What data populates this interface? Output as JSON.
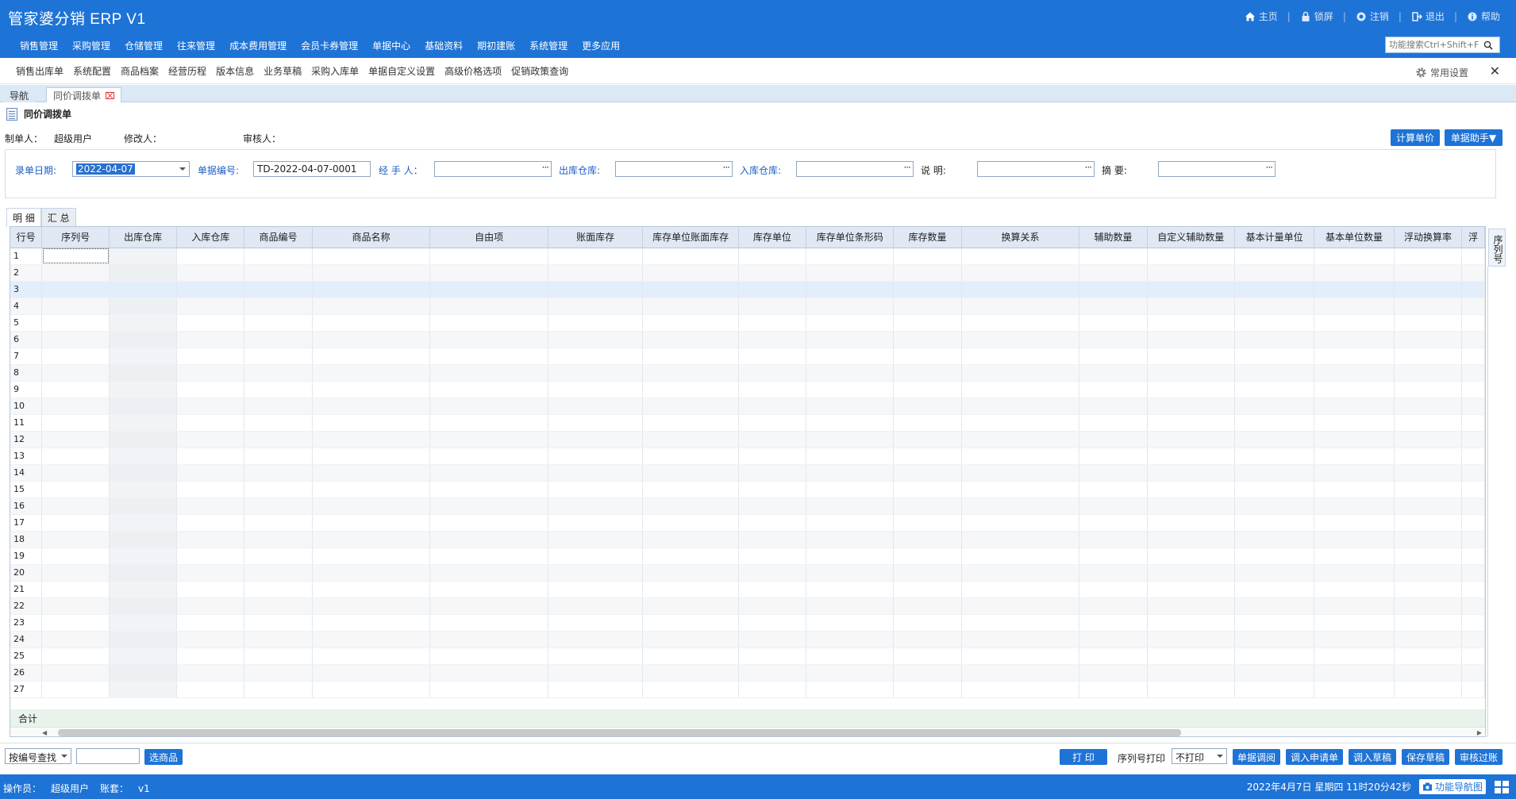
{
  "app": {
    "title": "管家婆分销 ERP V1"
  },
  "top_links": [
    {
      "icon": "home-icon",
      "label": "主页"
    },
    {
      "icon": "lock-icon",
      "label": "锁屏"
    },
    {
      "icon": "logout-circle-icon",
      "label": "注销"
    },
    {
      "icon": "exit-icon",
      "label": "退出"
    },
    {
      "icon": "help-icon",
      "label": "帮助"
    }
  ],
  "main_nav": [
    "销售管理",
    "采购管理",
    "仓储管理",
    "往来管理",
    "成本费用管理",
    "会员卡券管理",
    "单据中心",
    "基础资料",
    "期初建账",
    "系统管理",
    "更多应用"
  ],
  "search": {
    "placeholder": "功能搜索Ctrl+Shift+F"
  },
  "sub_nav": [
    "销售出库单",
    "系统配置",
    "商品档案",
    "经营历程",
    "版本信息",
    "业务草稿",
    "采购入库单",
    "单据自定义设置",
    "高级价格选项",
    "促销政策查询"
  ],
  "common_settings": "常用设置",
  "tabs": {
    "nav": "导航",
    "active": "同价调拨单"
  },
  "doc": {
    "title": "同价调拨单",
    "maker_label": "制单人：",
    "maker": "超级用户",
    "modifier_label": "修改人：",
    "modifier": "",
    "auditor_label": "审核人：",
    "auditor": ""
  },
  "buttons_top": {
    "calc_price": "计算单价",
    "doc_helper": "单据助手▼"
  },
  "form": {
    "date_label": "录单日期:",
    "date_value": "2022-04-07",
    "docno_label": "单据编号:",
    "docno_value": "TD-2022-04-07-0001",
    "handler_label": "经 手 人：",
    "handler_value": "",
    "out_wh_label": "出库仓库:",
    "out_wh_value": "",
    "in_wh_label": "入库仓库:",
    "in_wh_value": "",
    "note_label": "说       明:",
    "note_value": "",
    "summary_label": "摘       要:",
    "summary_value": ""
  },
  "section_tabs": [
    "明 细",
    "汇 总"
  ],
  "grid": {
    "columns": [
      "行号",
      "序列号",
      "出库仓库",
      "入库仓库",
      "商品编号",
      "商品名称",
      "自由项",
      "账面库存",
      "库存单位账面库存",
      "库存单位",
      "库存单位条形码",
      "库存数量",
      "换算关系",
      "辅助数量",
      "自定义辅助数量",
      "基本计量单位",
      "基本单位数量",
      "浮动换算率",
      "浮"
    ],
    "row_numbers": [
      "1",
      "2",
      "3",
      "4",
      "5",
      "6",
      "7",
      "8",
      "9",
      "10",
      "11",
      "12",
      "13",
      "14",
      "15",
      "16",
      "17",
      "18",
      "19",
      "20",
      "21",
      "22",
      "23",
      "24",
      "25",
      "26",
      "27"
    ],
    "total_label": "合计",
    "side_label": "序列号"
  },
  "bottom": {
    "lookup_mode": "按编号查找",
    "lookup_value": "",
    "select_goods": "选商品",
    "print": "打 印",
    "serial_print_label": "序列号打印",
    "serial_print_value": "不打印",
    "actions": [
      "单据调阅",
      "调入申请单",
      "调入草稿",
      "保存草稿",
      "审核过账"
    ]
  },
  "status": {
    "operator_label": "操作员：",
    "operator": "超级用户",
    "account_label": "账套：",
    "account": "v1",
    "datetime": "2022年4月7日  星期四  11时20分42秒",
    "nav_map": "功能导航图"
  },
  "colors": {
    "brand": "#1e73d6",
    "header_bg": "#dfe8f3",
    "total_bg": "#e8f3ec"
  }
}
